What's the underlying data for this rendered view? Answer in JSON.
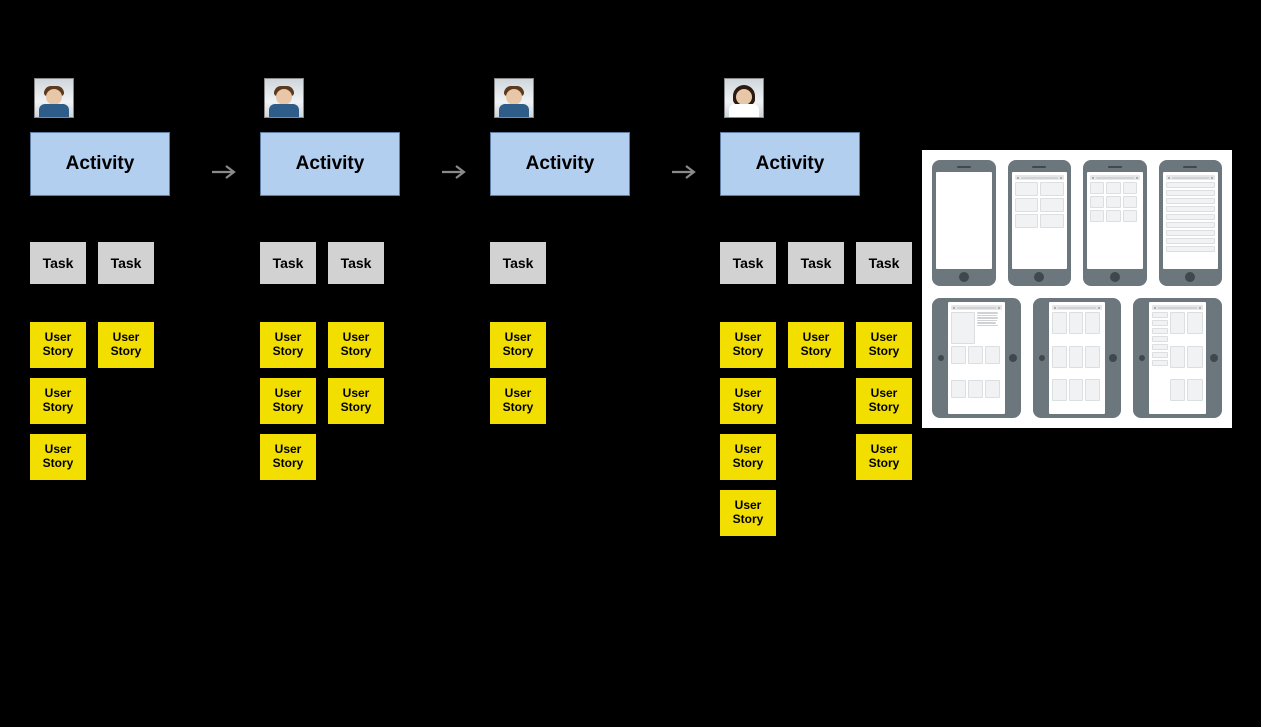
{
  "labels": {
    "activity": "Activity",
    "task": "Task",
    "user_story": "User Story"
  },
  "personas": [
    {
      "type": "male"
    },
    {
      "type": "male"
    },
    {
      "type": "male"
    },
    {
      "type": "female"
    }
  ],
  "lanes": [
    {
      "tasks": 2,
      "story_columns": [
        3,
        1
      ]
    },
    {
      "tasks": 2,
      "story_columns": [
        3,
        2
      ]
    },
    {
      "tasks": 1,
      "story_columns": [
        2
      ]
    },
    {
      "tasks": 3,
      "story_columns": [
        4,
        1,
        3
      ]
    }
  ],
  "wireframes": {
    "row1": [
      {
        "device": "phone",
        "layout": "blank"
      },
      {
        "device": "phone",
        "layout": "grid-2col"
      },
      {
        "device": "phone",
        "layout": "grid-3col"
      },
      {
        "device": "phone",
        "layout": "list"
      }
    ],
    "row2": [
      {
        "device": "tablet",
        "layout": "text-cards"
      },
      {
        "device": "tablet",
        "layout": "grid-3col"
      },
      {
        "device": "tablet",
        "layout": "sidebar-cards"
      }
    ]
  }
}
